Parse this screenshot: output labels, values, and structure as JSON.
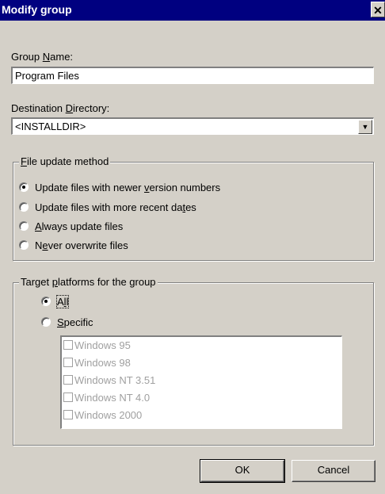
{
  "window": {
    "title": "Modify group",
    "close_glyph": "✕"
  },
  "group_name": {
    "label_pre": "Group ",
    "label_accel": "N",
    "label_post": "ame:",
    "value": "Program Files"
  },
  "destination": {
    "label_pre": "Destination ",
    "label_accel": "D",
    "label_post": "irectory:",
    "value": "<INSTALLDIR>"
  },
  "update_method": {
    "title_pre": "",
    "title_accel": "F",
    "title_post": "ile update method",
    "options": [
      {
        "pre": "Update files with newer ",
        "accel": "v",
        "post": "ersion numbers",
        "selected": true
      },
      {
        "pre": "Update files with more recent da",
        "accel": "t",
        "post": "es",
        "selected": false
      },
      {
        "pre": "",
        "accel": "A",
        "post": "lways update files",
        "selected": false
      },
      {
        "pre": "N",
        "accel": "e",
        "post": "ver overwrite files",
        "selected": false
      }
    ]
  },
  "platforms": {
    "title_pre": "Target ",
    "title_accel": "p",
    "title_post": "latforms for the group",
    "all": {
      "pre": "A",
      "accel": "l",
      "post": "l",
      "selected": true
    },
    "specific": {
      "pre": "",
      "accel": "S",
      "post": "pecific",
      "selected": false
    },
    "items": [
      "Windows 95",
      "Windows 98",
      "Windows NT 3.51",
      "Windows NT 4.0",
      "Windows 2000"
    ]
  },
  "buttons": {
    "ok": "OK",
    "cancel": "Cancel"
  }
}
